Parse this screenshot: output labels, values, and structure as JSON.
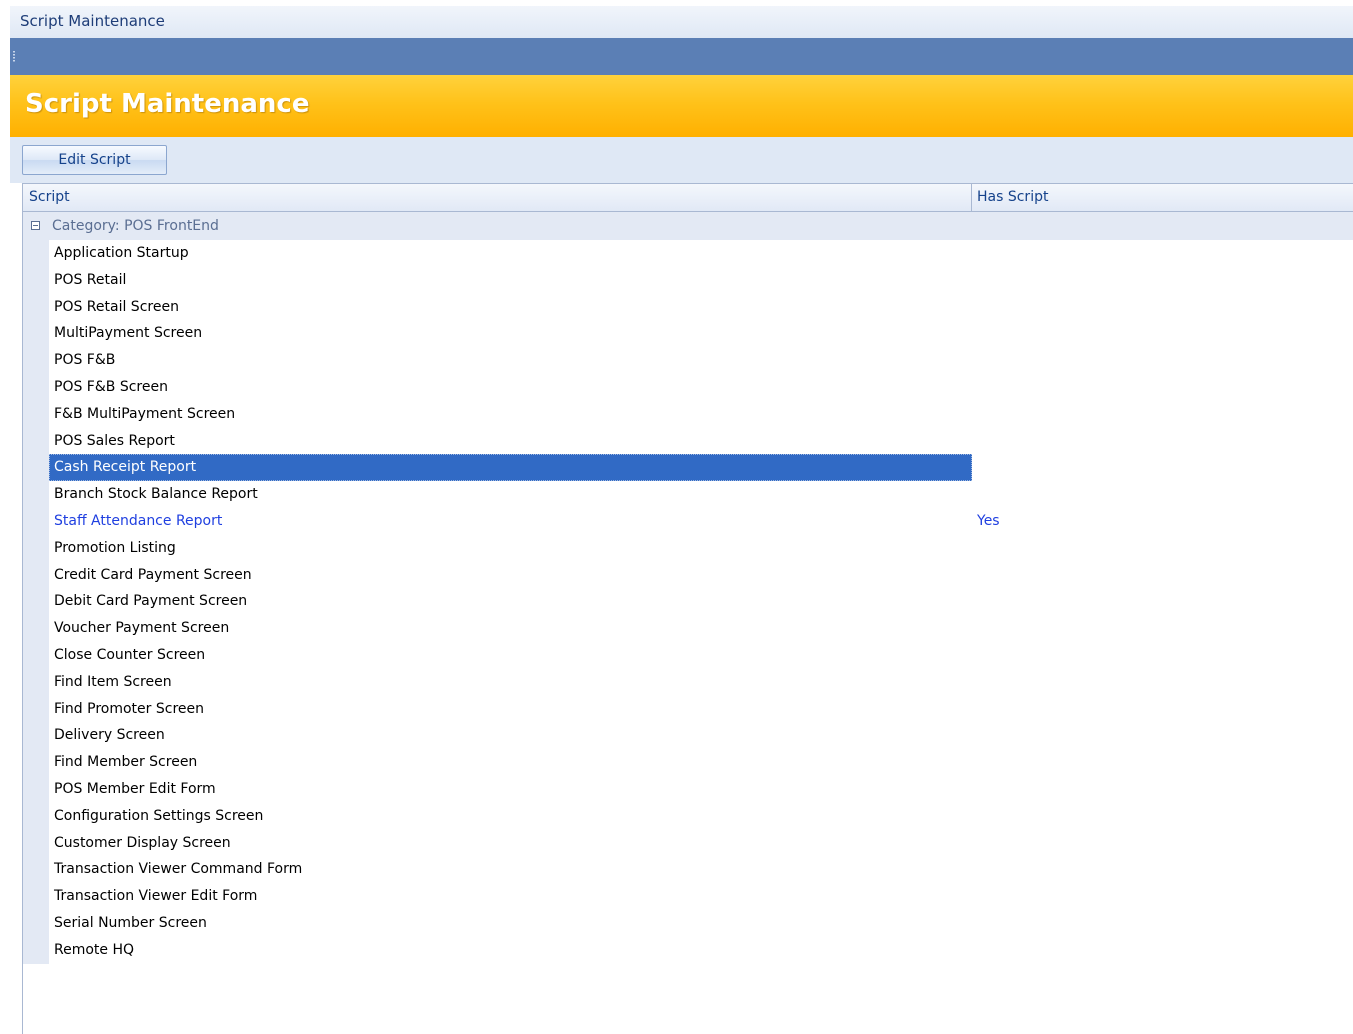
{
  "window": {
    "title": "Script Maintenance"
  },
  "header": {
    "title": "Script Maintenance"
  },
  "toolbar": {
    "edit_script_label": "Edit Script"
  },
  "grid": {
    "columns": {
      "script": "Script",
      "has_script": "Has Script"
    },
    "group_label": "Category: POS FrontEnd",
    "rows": [
      {
        "script": "Application Startup",
        "has_script": ""
      },
      {
        "script": "POS Retail",
        "has_script": ""
      },
      {
        "script": "POS Retail Screen",
        "has_script": ""
      },
      {
        "script": "MultiPayment Screen",
        "has_script": ""
      },
      {
        "script": "POS F&B",
        "has_script": ""
      },
      {
        "script": "POS F&B Screen",
        "has_script": ""
      },
      {
        "script": "F&B MultiPayment Screen",
        "has_script": ""
      },
      {
        "script": "POS Sales Report",
        "has_script": ""
      },
      {
        "script": "Cash Receipt Report",
        "has_script": "",
        "selected": true
      },
      {
        "script": "Branch Stock Balance Report",
        "has_script": ""
      },
      {
        "script": "Staff Attendance Report",
        "has_script": "Yes"
      },
      {
        "script": "Promotion Listing",
        "has_script": ""
      },
      {
        "script": "Credit Card Payment Screen",
        "has_script": ""
      },
      {
        "script": "Debit Card Payment Screen",
        "has_script": ""
      },
      {
        "script": "Voucher Payment Screen",
        "has_script": ""
      },
      {
        "script": "Close Counter Screen",
        "has_script": ""
      },
      {
        "script": "Find Item Screen",
        "has_script": ""
      },
      {
        "script": "Find Promoter Screen",
        "has_script": ""
      },
      {
        "script": "Delivery Screen",
        "has_script": ""
      },
      {
        "script": "Find Member Screen",
        "has_script": ""
      },
      {
        "script": "POS Member Edit Form",
        "has_script": ""
      },
      {
        "script": "Configuration Settings Screen",
        "has_script": ""
      },
      {
        "script": "Customer Display Screen",
        "has_script": ""
      },
      {
        "script": "Transaction Viewer Command Form",
        "has_script": ""
      },
      {
        "script": "Transaction Viewer Edit Form",
        "has_script": ""
      },
      {
        "script": "Serial Number Screen",
        "has_script": ""
      },
      {
        "script": "Remote HQ",
        "has_script": ""
      }
    ]
  },
  "colors": {
    "accent_yellow": "#ffb000",
    "toolbar_blue": "#5b7fb5",
    "selection": "#316ac5",
    "has_script_text": "#1f3fe0"
  },
  "icons": {
    "group_toggle": "collapse-minus-icon"
  }
}
